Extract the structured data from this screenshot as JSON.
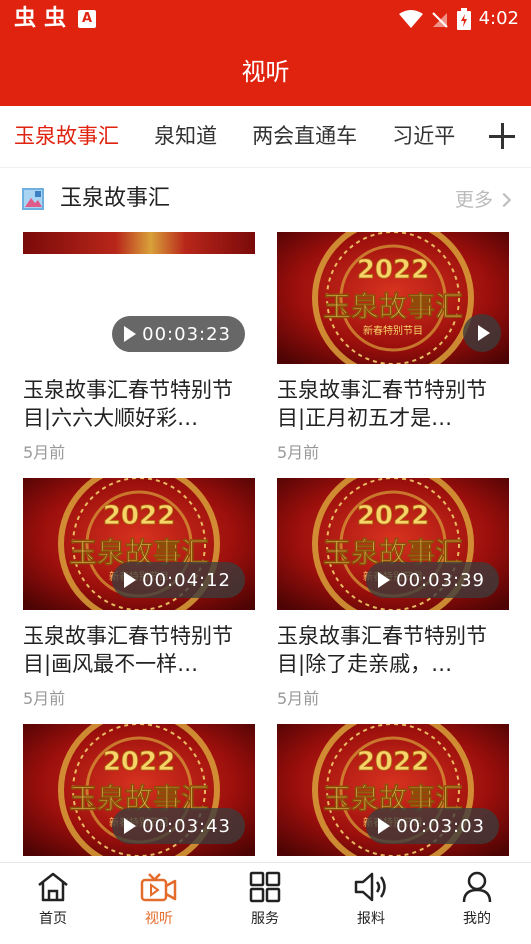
{
  "status_bar": {
    "left_glyphs": [
      "虫",
      "虫"
    ],
    "app_badge": "A",
    "time": "4:02"
  },
  "header": {
    "title": "视听"
  },
  "tabs": [
    {
      "label": "玉泉故事汇",
      "active": true
    },
    {
      "label": "泉知道",
      "active": false
    },
    {
      "label": "两会直通车",
      "active": false
    },
    {
      "label": "习近平",
      "active": false
    }
  ],
  "section": {
    "title": "玉泉故事汇",
    "more_label": "更多"
  },
  "videos": [
    {
      "title": "玉泉故事汇春节特别节目|六六大顺好彩…",
      "duration": "00:03:23",
      "age": "5月前"
    },
    {
      "title": "玉泉故事汇春节特别节目|正月初五才是…",
      "duration": "",
      "age": "5月前"
    },
    {
      "title": "玉泉故事汇春节特别节目|画风最不一样…",
      "duration": "00:04:12",
      "age": "5月前"
    },
    {
      "title": "玉泉故事汇春节特别节目|除了走亲戚，…",
      "duration": "00:03:39",
      "age": "5月前"
    },
    {
      "title": "",
      "duration": "00:03:43",
      "age": ""
    },
    {
      "title": "",
      "duration": "00:03:03",
      "age": ""
    }
  ],
  "thumb_text": {
    "year": "2022",
    "banner": "玉泉故事汇",
    "subtitle": "新春特别节目"
  },
  "bottom_nav": [
    {
      "label": "首页",
      "icon": "home-icon",
      "active": false
    },
    {
      "label": "视听",
      "icon": "video-icon",
      "active": true
    },
    {
      "label": "服务",
      "icon": "grid-icon",
      "active": false
    },
    {
      "label": "报料",
      "icon": "speaker-icon",
      "active": false
    },
    {
      "label": "我的",
      "icon": "user-icon",
      "active": false
    }
  ],
  "colors": {
    "brand_red": "#e0230f",
    "active_nav": "#e36b2b",
    "muted": "#999999"
  }
}
